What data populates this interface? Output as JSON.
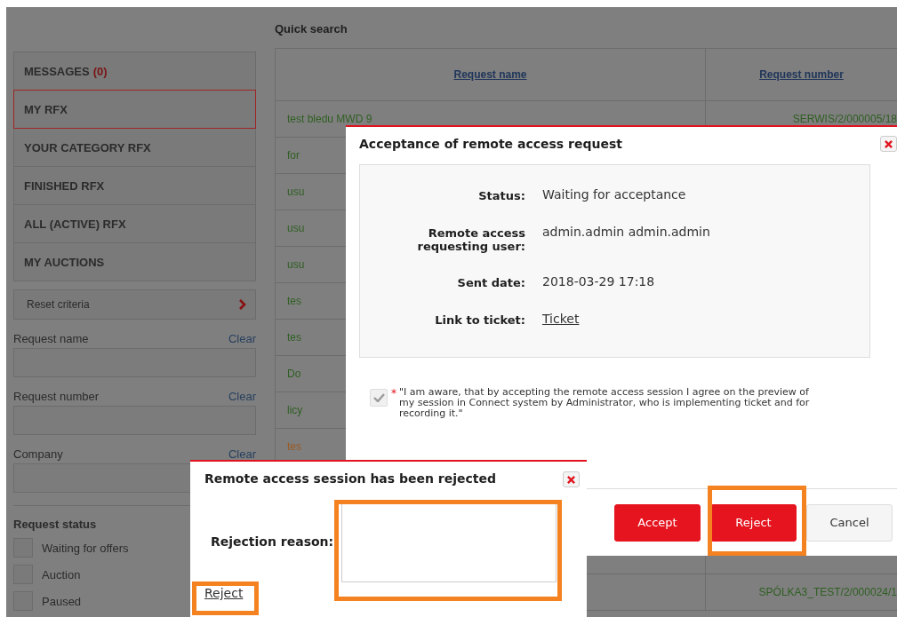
{
  "sidebar": {
    "menu": [
      {
        "label": "MESSAGES",
        "count": "(0)",
        "selected": false
      },
      {
        "label": "MY RFX",
        "selected": true
      },
      {
        "label": "YOUR CATEGORY RFX",
        "selected": false
      },
      {
        "label": "FINISHED RFX",
        "selected": false
      },
      {
        "label": "ALL (ACTIVE) RFX",
        "selected": false
      },
      {
        "label": "MY AUCTIONS",
        "selected": false
      }
    ],
    "reset": "Reset criteria",
    "filters": [
      {
        "label": "Request name",
        "clear": "Clear"
      },
      {
        "label": "Request number",
        "clear": "Clear"
      },
      {
        "label": "Company",
        "clear": "Clear"
      }
    ],
    "status_heading": "Request status",
    "statuses": [
      {
        "label": "Waiting for offers",
        "checked": false
      },
      {
        "label": "Auction",
        "checked": false
      },
      {
        "label": "Paused",
        "checked": false
      }
    ]
  },
  "main": {
    "title": "Quick search",
    "columns": [
      "Request name",
      "Request number"
    ],
    "rows": [
      {
        "name": "test bledu MWD 9",
        "number": "SERWIS/2/000005/18",
        "color": "#2f5f22"
      },
      {
        "name": "for",
        "color": "#2f5f22"
      },
      {
        "name": "usu",
        "color": "#2f5f22"
      },
      {
        "name": "usu",
        "color": "#2f5f22"
      },
      {
        "name": "usu",
        "color": "#2f5f22"
      },
      {
        "name": "tes",
        "color": "#2f5f22"
      },
      {
        "name": "tes",
        "color": "#2f5f22"
      },
      {
        "name": "Do",
        "color": "#2f5f22"
      },
      {
        "name": "licy",
        "color": "#2f5f22"
      },
      {
        "name": "tes",
        "color": "#9a5a22"
      },
      {
        "number": "SPÓLKA3_TEST/2/000024/1",
        "color": "#2f5f22"
      }
    ]
  },
  "acceptance_dialog": {
    "title": "Acceptance of remote access request",
    "fields": [
      {
        "label": "Status:",
        "value": "Waiting for acceptance",
        "kind": "text"
      },
      {
        "label": "Remote access requesting user:",
        "value": "admin.admin admin.admin",
        "kind": "text"
      },
      {
        "label": "Sent date:",
        "value": "2018-03-29 17:18",
        "kind": "text"
      },
      {
        "label": "Link to ticket:",
        "value": "Ticket",
        "kind": "link"
      }
    ],
    "consent": {
      "checked": true,
      "required_mark": "*",
      "text": "\"I am aware, that by accepting the remote access session I agree on the preview of my session in Connect system by Administrator, who is implementing ticket and for recording it.\""
    },
    "buttons": [
      {
        "label": "Accept",
        "kind": "primary"
      },
      {
        "label": "Reject",
        "kind": "primary"
      },
      {
        "label": "Cancel",
        "kind": "default"
      }
    ]
  },
  "rejection_dialog": {
    "title": "Remote access session has been rejected",
    "field_label": "Rejection reason:",
    "link": "Reject"
  }
}
